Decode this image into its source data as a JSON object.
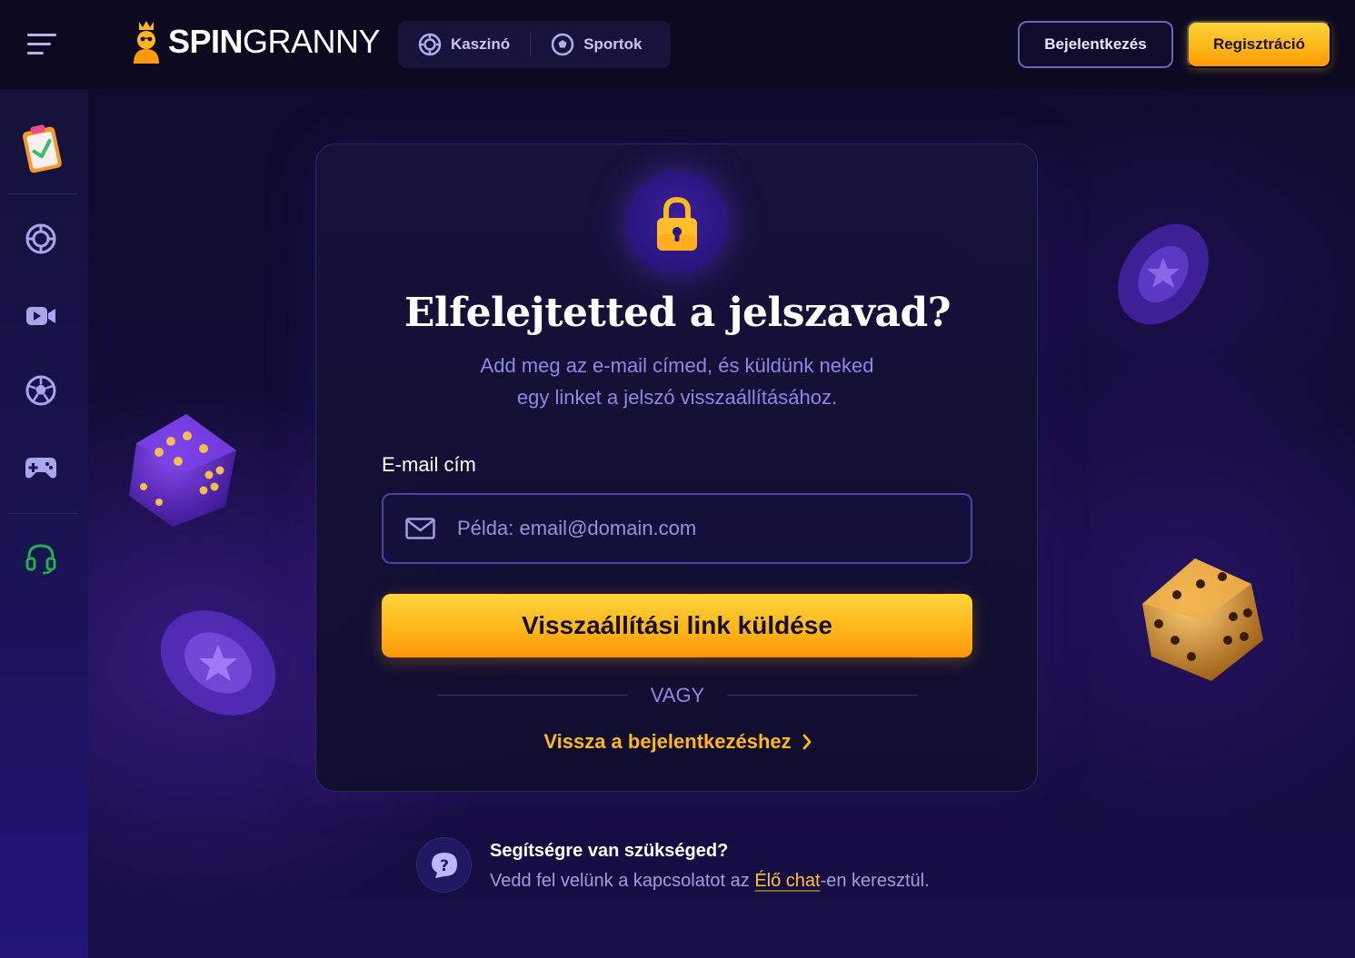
{
  "header": {
    "logo": {
      "bold": "SPIN",
      "light": "GRANNY"
    },
    "nav": [
      {
        "label": "Kaszinó",
        "icon": "casino-chip-icon"
      },
      {
        "label": "Sportok",
        "icon": "soccer-ball-icon"
      }
    ],
    "login_label": "Bejelentkezés",
    "register_label": "Regisztráció"
  },
  "sidebar": {
    "items": [
      {
        "name": "tasks",
        "icon": "clipboard-check-icon"
      },
      {
        "name": "casino",
        "icon": "casino-chip-icon"
      },
      {
        "name": "live-casino",
        "icon": "video-camera-icon"
      },
      {
        "name": "sports",
        "icon": "soccer-ball-icon"
      },
      {
        "name": "games",
        "icon": "gamepad-icon"
      },
      {
        "name": "support",
        "icon": "headset-icon"
      }
    ]
  },
  "form": {
    "title": "Elfelejtetted a jelszavad?",
    "subtitle_line1": "Add meg az e-mail címed, és küldünk neked",
    "subtitle_line2": "egy linket a jelszó visszaállításához.",
    "email_label": "E-mail cím",
    "email_placeholder": "Példa: email@domain.com",
    "email_value": "",
    "submit_label": "Visszaállítási link küldése",
    "or_label": "VAGY",
    "back_label": "Vissza a bejelentkezéshez"
  },
  "help": {
    "title": "Segítségre van szükséged?",
    "text_before": "Vedd fel velünk a kapcsolatot az ",
    "chat_link": "Élő chat",
    "text_after": "-en keresztül."
  },
  "colors": {
    "accent": "#ffb81f",
    "background": "#0c0a26",
    "card": "#16123c",
    "muted_text": "#8f88e6",
    "support_icon": "#22b04a"
  }
}
